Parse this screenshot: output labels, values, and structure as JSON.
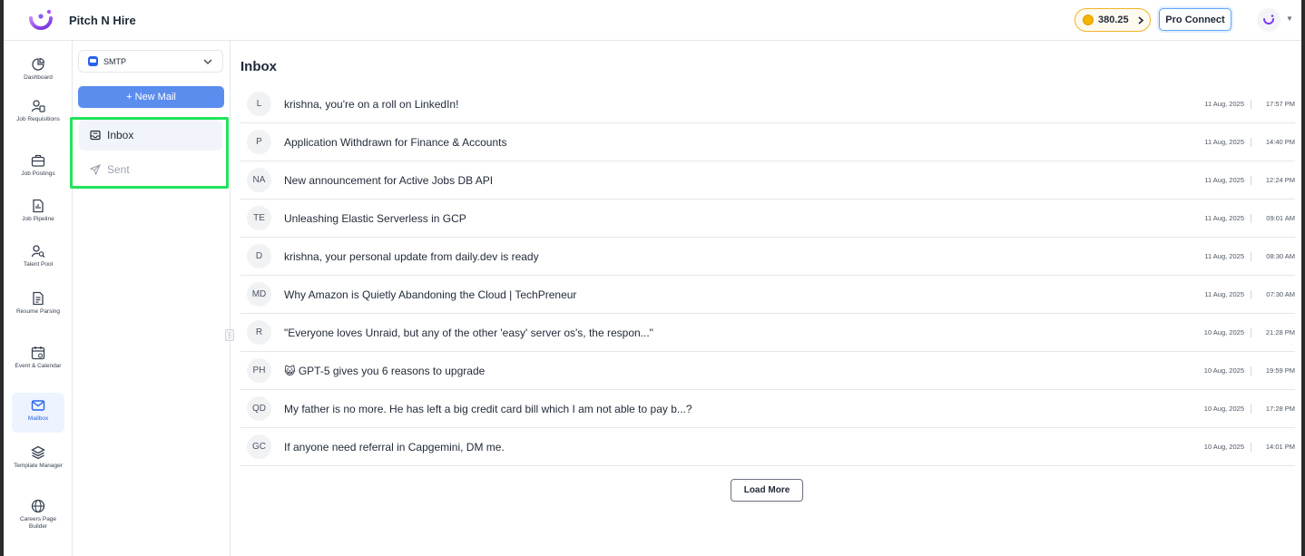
{
  "header": {
    "app_title": "Pitch N Hire",
    "coins": "380.25",
    "pro_connect": "Pro Connect"
  },
  "rail": {
    "items": [
      {
        "label": "Dashboard",
        "icon": "pie-chart-icon"
      },
      {
        "label": "Job Requisitions",
        "icon": "user-doc-icon"
      },
      {
        "label": "Job Postings",
        "icon": "briefcase-icon"
      },
      {
        "label": "Job Pipeline",
        "icon": "pipeline-icon"
      },
      {
        "label": "Talent Pool",
        "icon": "user-search-icon"
      },
      {
        "label": "Resume Parsing",
        "icon": "document-icon"
      },
      {
        "label": "Event & Calendar",
        "icon": "calendar-icon"
      },
      {
        "label": "Mailbox",
        "icon": "mail-icon"
      },
      {
        "label": "Template Manager",
        "icon": "layers-icon"
      },
      {
        "label": "Careers Page Builder",
        "icon": "globe-icon"
      }
    ],
    "active": "Mailbox"
  },
  "folders": {
    "account": "SMTP",
    "new_mail": "+ New Mail",
    "inbox": "Inbox",
    "sent": "Sent"
  },
  "main": {
    "title": "Inbox",
    "load_more": "Load More",
    "mails": [
      {
        "initials": "L",
        "subject": "krishna, you're on a roll on LinkedIn!",
        "date": "11 Aug, 2025",
        "time": "17:57 PM"
      },
      {
        "initials": "P",
        "subject": "Application Withdrawn for Finance & Accounts",
        "date": "11 Aug, 2025",
        "time": "14:40 PM"
      },
      {
        "initials": "NA",
        "subject": "New announcement for Active Jobs DB API",
        "date": "11 Aug, 2025",
        "time": "12:24 PM"
      },
      {
        "initials": "TE",
        "subject": "Unleashing Elastic Serverless in GCP",
        "date": "11 Aug, 2025",
        "time": "09:01 AM"
      },
      {
        "initials": "D",
        "subject": "krishna, your personal update from daily.dev is ready",
        "date": "11 Aug, 2025",
        "time": "08:30 AM"
      },
      {
        "initials": "MD",
        "subject": "Why Amazon is Quietly Abandoning the Cloud | TechPreneur",
        "date": "11 Aug, 2025",
        "time": "07:30 AM"
      },
      {
        "initials": "R",
        "subject": "\"Everyone loves Unraid, but any of the other 'easy' server os's, the respon...\"",
        "date": "10 Aug, 2025",
        "time": "21:28 PM"
      },
      {
        "initials": "PH",
        "subject": "😺 GPT-5 gives you 6 reasons to upgrade",
        "date": "10 Aug, 2025",
        "time": "19:59 PM"
      },
      {
        "initials": "QD",
        "subject": "My father is no more. He has left a big credit card bill which I am not able to pay b...?",
        "date": "10 Aug, 2025",
        "time": "17:28 PM"
      },
      {
        "initials": "GC",
        "subject": "If anyone need referral in Capgemini, DM me.",
        "date": "10 Aug, 2025",
        "time": "14:01 PM"
      }
    ]
  },
  "colors": {
    "accent": "#5b8def",
    "highlight": "#22e35b",
    "coin": "#f5b400"
  }
}
